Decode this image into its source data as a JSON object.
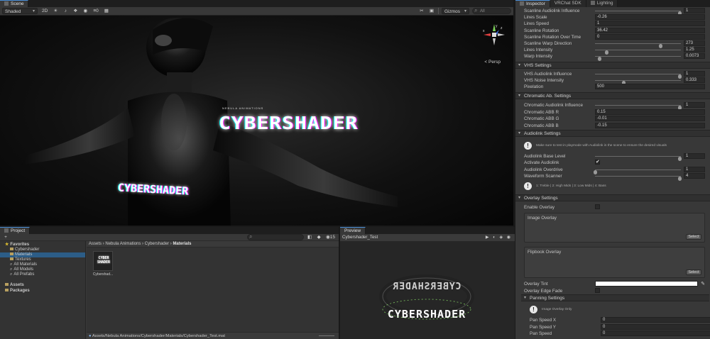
{
  "scene": {
    "tab": "Scene",
    "toolbar": {
      "shading_mode": "Shaded",
      "mode_2d": "2D",
      "count_badge": "0",
      "gizmos": "Gizmos",
      "search_placeholder": "All"
    },
    "overlay_text_big": "CYBERSHADER",
    "overlay_text_sub": "NEBULA ANIMATIONS",
    "overlay_text_small": "CYBERSHADER",
    "gizmo_label": "< Persp",
    "gizmo_axes": {
      "x": "x",
      "y": "y",
      "z": "z"
    }
  },
  "inspector": {
    "tabs": [
      "Inspector",
      "VRChat SDK",
      "Lighting"
    ],
    "scanline_rows": [
      {
        "label": "Scanline Audiolink Influence",
        "value": "1",
        "type": "slider",
        "fraction": 0.98
      },
      {
        "label": "Lines Scale",
        "value": "-0.26",
        "type": "field"
      },
      {
        "label": "Lines Speed",
        "value": "1",
        "type": "field"
      },
      {
        "label": "Scanline Rotation",
        "value": "36.42",
        "type": "field"
      },
      {
        "label": "Scanline Rotation Over Time",
        "value": "0",
        "type": "field"
      },
      {
        "label": "Scanline Warp Direction",
        "value": "273",
        "type": "slider",
        "fraction": 0.76
      },
      {
        "label": "Lines Intensity",
        "value": "1.25",
        "type": "slider",
        "fraction": 0.13
      },
      {
        "label": "Warp Intensity",
        "value": "0.0073",
        "type": "slider",
        "fraction": 0.05
      }
    ],
    "vhs": {
      "title": "VHS Settings",
      "rows": [
        {
          "label": "VHS Audiolink Influence",
          "value": "1",
          "type": "slider",
          "fraction": 0.98
        },
        {
          "label": "VHS Noise Intensity",
          "value": "0.333",
          "type": "slider",
          "fraction": 0.33
        },
        {
          "label": "Pixelation",
          "value": "500",
          "type": "field"
        }
      ]
    },
    "chromatic": {
      "title": "Chromatic Ab. Settings",
      "rows": [
        {
          "label": "Chromatic Audiolink Influence",
          "value": "1",
          "type": "slider",
          "fraction": 0.98
        },
        {
          "label": "Chromatic ABB R",
          "value": "0.15",
          "type": "field"
        },
        {
          "label": "Chromatic ABB G",
          "value": "-0.01",
          "type": "field"
        },
        {
          "label": "Chromatic ABB B",
          "value": "-0.15",
          "type": "field"
        }
      ]
    },
    "audiolink": {
      "title": "Audiolink Settings",
      "info": "Make sure to test in playmode with Audiolink in the scene to ensure the desired visuals",
      "rows": [
        {
          "label": "Audiolink Base Level",
          "value": "1",
          "type": "slider",
          "fraction": 0.98
        },
        {
          "label": "Activate Audiolink",
          "value": "✔",
          "type": "check"
        },
        {
          "label": "Audiolink Overdrive",
          "value": "1",
          "type": "slider",
          "fraction": 0.0
        },
        {
          "label": "Waveform Scanner",
          "value": "4",
          "type": "slider",
          "fraction": 0.98
        }
      ],
      "band_info": "1: Treble | 2: High Mids | 3: Low Mids | 4: Bass"
    },
    "overlay": {
      "title": "Overlay Settings",
      "enable_label": "Enable Overlay",
      "image_overlay": "Image Overlay",
      "flipbook_overlay": "Flipbook Overlay",
      "select_label": "Select",
      "tint_label": "Overlay Tint",
      "tint_color": "#ffffff",
      "edge_fade_label": "Overlay Edge Fade"
    },
    "panning": {
      "title": "Panning Settings",
      "info": "Image Overlay Only",
      "rows": [
        {
          "label": "Pan Speed X",
          "value": "0"
        },
        {
          "label": "Pan Speed Y",
          "value": "0"
        },
        {
          "label": "Pan Speed",
          "value": "0"
        }
      ]
    }
  },
  "project": {
    "tab": "Project",
    "add_label": "+",
    "tree": [
      {
        "label": "Favorites",
        "kind": "header-star"
      },
      {
        "label": "Cybershader",
        "kind": "folder"
      },
      {
        "label": "Materials",
        "kind": "folder",
        "selected": true
      },
      {
        "label": "Textures",
        "kind": "folder"
      },
      {
        "label": "All Materials",
        "kind": "search"
      },
      {
        "label": "All Models",
        "kind": "search"
      },
      {
        "label": "All Prefabs",
        "kind": "search"
      },
      {
        "label": "",
        "kind": "spacer"
      },
      {
        "label": "Assets",
        "kind": "header-folder"
      },
      {
        "label": "Packages",
        "kind": "header-folder"
      }
    ],
    "breadcrumb": [
      "Assets",
      "Nebula Animations",
      "Cybershader",
      "Materials"
    ],
    "asset_name": "Cybershad...",
    "asset_thumb_text": "CYBER SHADER",
    "status_path": "Assets/Nebula Animations/Cybershader/Materials/Cybershader_Test.mat",
    "badge_count": "15"
  },
  "preview": {
    "tab": "Preview",
    "title": "Cybershader_Test",
    "ring_text": "CYBERSHADER"
  }
}
